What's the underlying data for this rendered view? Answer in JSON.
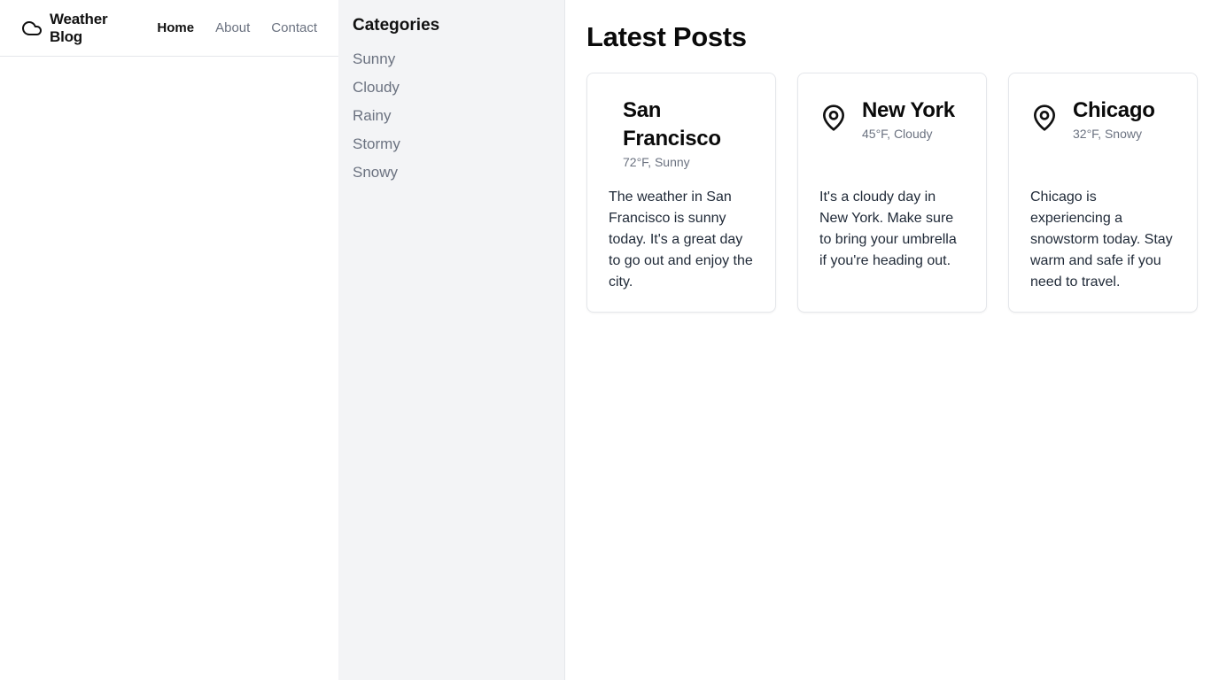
{
  "header": {
    "brand": "Weather Blog",
    "nav": [
      {
        "label": "Home",
        "active": true
      },
      {
        "label": "About",
        "active": false
      },
      {
        "label": "Contact",
        "active": false
      }
    ]
  },
  "sidebar": {
    "title": "Categories",
    "items": [
      "Sunny",
      "Cloudy",
      "Rainy",
      "Stormy",
      "Snowy"
    ]
  },
  "main": {
    "title": "Latest Posts",
    "posts": [
      {
        "city": "San Francisco",
        "temp": "72°F, Sunny",
        "icon": "none",
        "text": "The weather in San Francisco is sunny today. It's a great day to go out and enjoy the city."
      },
      {
        "city": "New York",
        "temp": "45°F, Cloudy",
        "icon": "map-pin-icon",
        "text": "It's a cloudy day in New York. Make sure to bring your umbrella if you're heading out."
      },
      {
        "city": "Chicago",
        "temp": "32°F, Snowy",
        "icon": "map-pin-icon",
        "text": "Chicago is experiencing a snowstorm today. Stay warm and safe if you need to travel."
      }
    ]
  },
  "colors": {
    "sidebar_bg": "#f3f4f6",
    "muted_text": "#6b7280",
    "border": "#e5e7eb"
  }
}
